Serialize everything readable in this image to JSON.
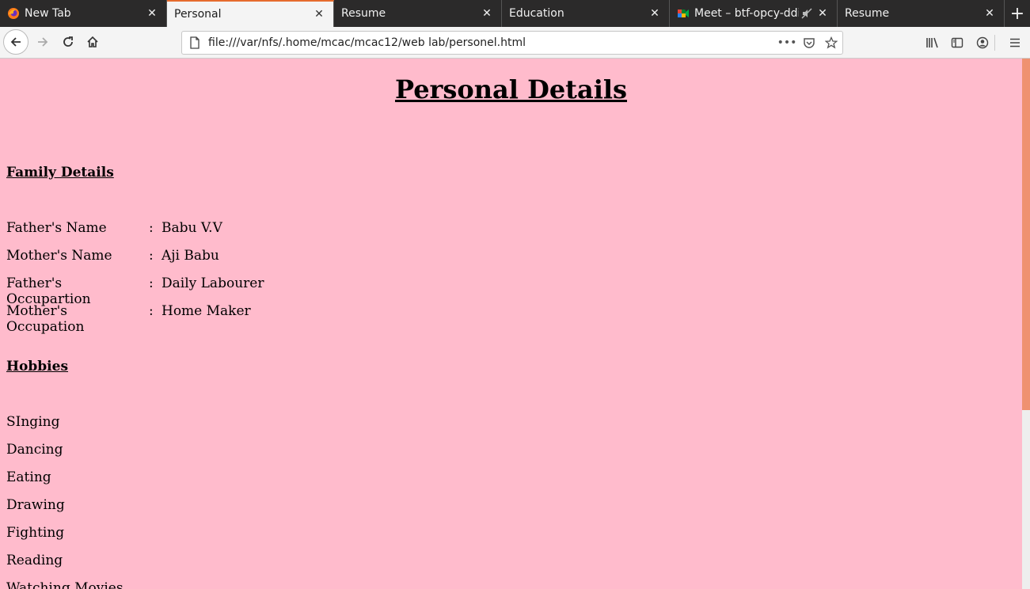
{
  "tabs": [
    {
      "title": "New Tab",
      "icon": "firefox-icon",
      "active": false
    },
    {
      "title": "Personal",
      "icon": "none",
      "active": true
    },
    {
      "title": "Resume",
      "icon": "none",
      "active": false
    },
    {
      "title": "Education",
      "icon": "none",
      "active": false
    },
    {
      "title": "Meet – btf-opcy-ddi",
      "icon": "google-meet-icon",
      "active": false
    },
    {
      "title": "Resume",
      "icon": "none",
      "active": false
    }
  ],
  "urlbar": {
    "url": "file:///var/nfs/.home/mcac/mcac12/web lab/personel.html"
  },
  "page": {
    "title": "Personal Details",
    "family": {
      "heading": "Family Details",
      "rows": [
        {
          "label": "Father's Name",
          "value": "Babu V.V"
        },
        {
          "label": "Mother's Name",
          "value": "Aji Babu"
        },
        {
          "label": "Father's Occupartion",
          "value": "Daily Labourer"
        },
        {
          "label": "Mother's Occupation",
          "value": "Home Maker"
        }
      ],
      "separator": ":"
    },
    "hobbies": {
      "heading": "Hobbies",
      "items": [
        "SInging",
        "Dancing",
        "Eating",
        "Drawing",
        "Fighting",
        "Reading",
        "Watching Movies"
      ]
    }
  },
  "colors": {
    "page_bg": "#ffbbcc",
    "tab_accent": "#e66b2e",
    "scroll_thumb": "#ef9170"
  }
}
